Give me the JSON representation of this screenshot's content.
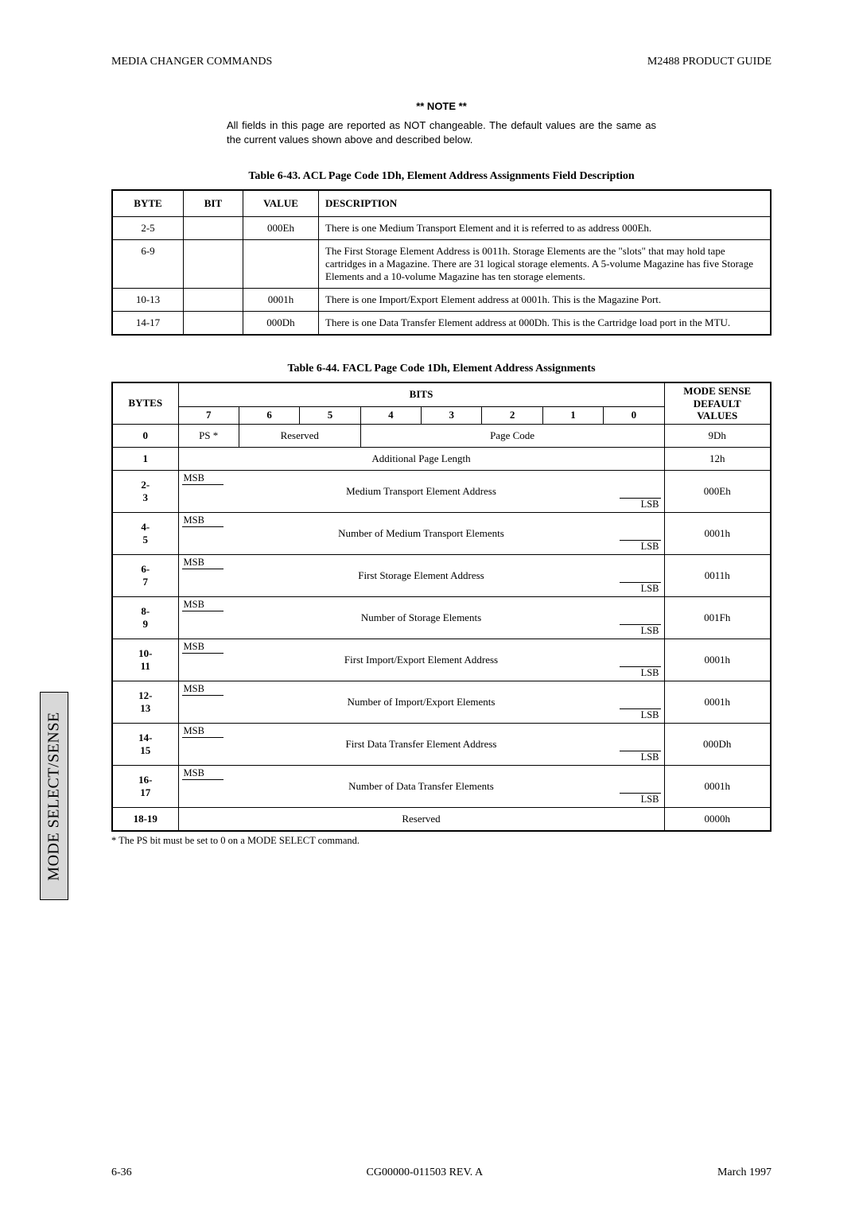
{
  "header": {
    "left": "MEDIA CHANGER COMMANDS",
    "right": "M2488 PRODUCT GUIDE"
  },
  "note": {
    "title": "** NOTE **",
    "text": "All fields in this page are reported as NOT changeable. The default values are the same as the current values shown above and described below."
  },
  "table43": {
    "caption": "Table 6-43.   ACL Page Code 1Dh, Element Address Assignments Field Description",
    "head": {
      "byte": "BYTE",
      "bit": "BIT",
      "value": "VALUE",
      "desc": "DESCRIPTION"
    },
    "rows": [
      {
        "byte": "2-5",
        "bit": "",
        "value": "000Eh",
        "desc": "There is one Medium Transport Element and it is referred to as address 000Eh."
      },
      {
        "byte": "6-9",
        "bit": "",
        "value": "",
        "desc": "The First Storage Element Address is 0011h. Storage Elements are the \"slots\" that may hold tape cartridges in a Magazine. There are 31 logical storage elements. A 5-volume Magazine has five Storage Elements and a 10-volume Magazine has ten storage elements."
      },
      {
        "byte": "10-13",
        "bit": "",
        "value": "0001h",
        "desc": "There is one Import/Export Element address at 0001h. This is the Magazine Port."
      },
      {
        "byte": "14-17",
        "bit": "",
        "value": "000Dh",
        "desc": "There is one Data Transfer Element address at 000Dh. This is the Cartridge load port in the MTU."
      }
    ]
  },
  "table44": {
    "caption": "Table 6-44.   FACL Page Code 1Dh, Element Address Assignments",
    "bitsLabel": "BITS",
    "msLabel1": "MODE SENSE",
    "msLabel2": "DEFAULT",
    "msLabel3": "VALUES",
    "bytesLabel": "BYTES",
    "bitHeaders": [
      "7",
      "6",
      "5",
      "4",
      "3",
      "2",
      "1",
      "0"
    ],
    "rows": [
      {
        "bytes": "0",
        "cells": [
          {
            "span": 1,
            "text": "PS *"
          },
          {
            "span": 2,
            "text": "Reserved"
          },
          {
            "span": 5,
            "text": "Page Code"
          }
        ],
        "value": "9Dh"
      },
      {
        "bytes": "1",
        "cells": [
          {
            "span": 8,
            "text": "Additional Page Length"
          }
        ],
        "value": "12h"
      },
      {
        "bytes": "2-\n3",
        "field": "Medium Transport Element Address",
        "value": "000Eh"
      },
      {
        "bytes": "4-\n5",
        "field": "Number of Medium Transport Elements",
        "value": "0001h"
      },
      {
        "bytes": "6-\n7",
        "field": "First Storage Element Address",
        "value": "0011h"
      },
      {
        "bytes": "8-\n9",
        "field": "Number of Storage Elements",
        "value": "001Fh"
      },
      {
        "bytes": "10-\n11",
        "field": "First Import/Export Element Address",
        "value": "0001h"
      },
      {
        "bytes": "12-\n13",
        "field": "Number of Import/Export Elements",
        "value": "0001h"
      },
      {
        "bytes": "14-\n15",
        "field": "First Data Transfer Element Address",
        "value": "000Dh"
      },
      {
        "bytes": "16-\n17",
        "field": "Number of Data Transfer Elements",
        "value": "0001h"
      },
      {
        "bytes": "18-19",
        "cells": [
          {
            "span": 8,
            "text": "Reserved"
          }
        ],
        "value": "0000h"
      }
    ],
    "msb": "MSB",
    "lsb": "LSB"
  },
  "footnote": "* The PS bit must be set to 0 on a MODE SELECT command.",
  "sideTab": "MODE SELECT/SENSE",
  "footer": {
    "left": "6-36",
    "center": "CG00000-011503 REV. A",
    "right": "March 1997"
  }
}
